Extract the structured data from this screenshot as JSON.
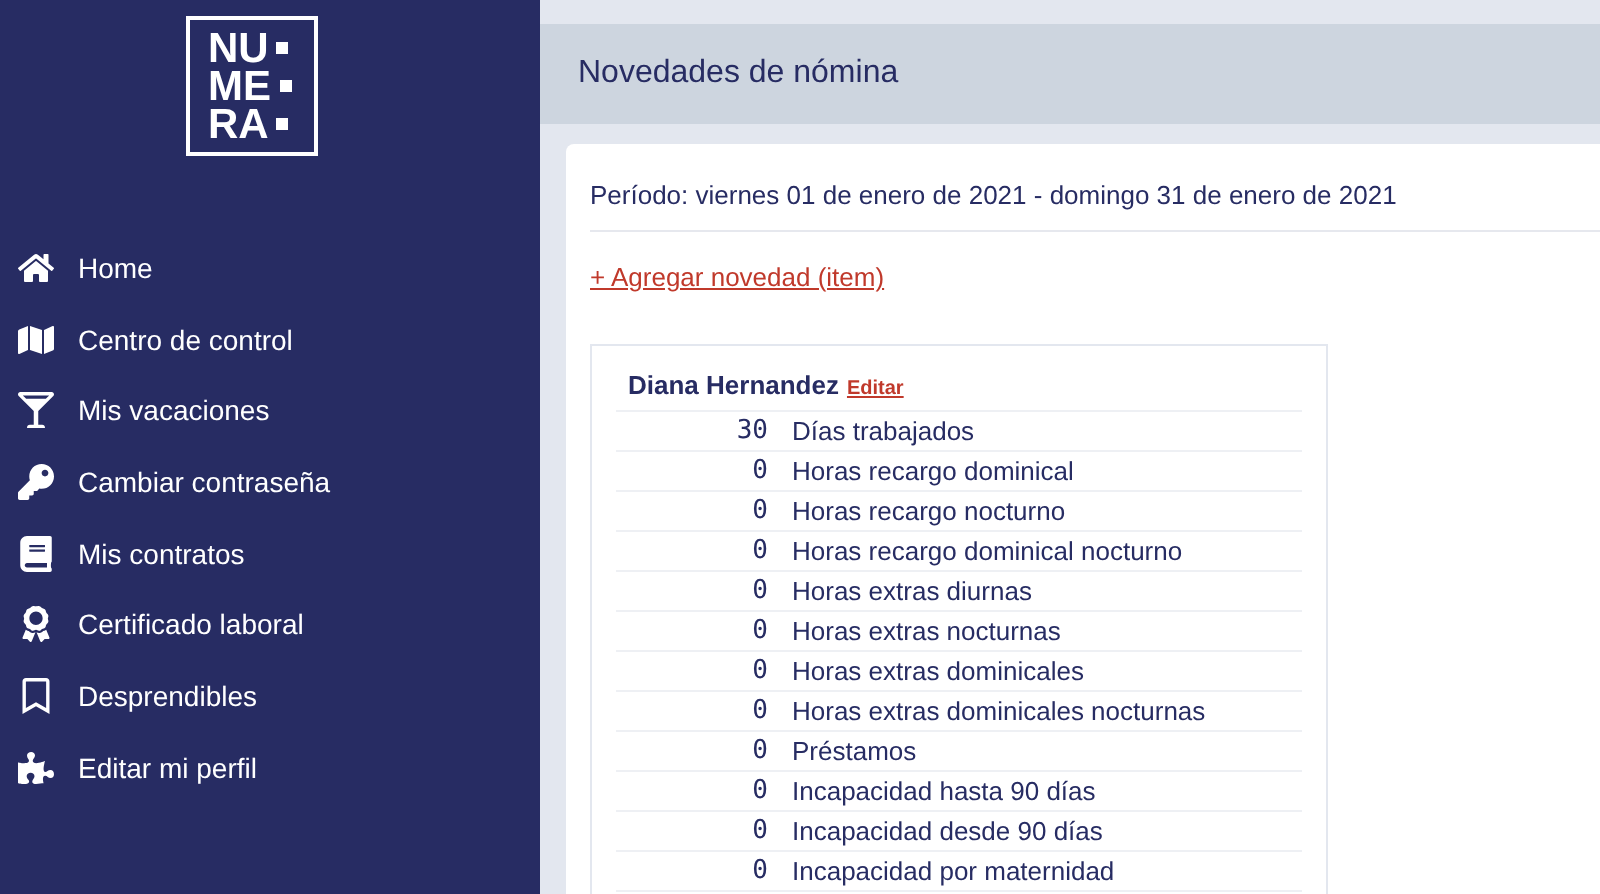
{
  "logo": {
    "lines": [
      "NU",
      "ME",
      "RA"
    ]
  },
  "sidebar": {
    "items": [
      {
        "label": "Home",
        "selected": false
      },
      {
        "label": "Centro de control",
        "selected": false
      },
      {
        "label": "Mis vacaciones",
        "selected": false
      },
      {
        "label": "Cambiar contraseña",
        "selected": false
      },
      {
        "label": "Mis contratos",
        "selected": false
      },
      {
        "label": "Certificado laboral",
        "selected": false
      },
      {
        "label": "Desprendibles",
        "selected": false
      },
      {
        "label": "Editar mi perfil",
        "selected": false
      }
    ]
  },
  "header": {
    "title": "Novedades de nómina"
  },
  "period": "Período: viernes 01 de enero de 2021 - domingo 31 de enero de 2021",
  "add_link": "+ Agregar novedad (item)",
  "employee": {
    "name": "Diana Hernandez",
    "edit_link": "Editar",
    "rows": [
      {
        "value": "30",
        "label": "Días trabajados"
      },
      {
        "value": "0",
        "label": "Horas recargo dominical"
      },
      {
        "value": "0",
        "label": "Horas recargo nocturno"
      },
      {
        "value": "0",
        "label": "Horas recargo dominical nocturno"
      },
      {
        "value": "0",
        "label": "Horas extras diurnas"
      },
      {
        "value": "0",
        "label": "Horas extras nocturnas"
      },
      {
        "value": "0",
        "label": "Horas extras dominicales"
      },
      {
        "value": "0",
        "label": "Horas extras dominicales nocturnas"
      },
      {
        "value": "0",
        "label": "Préstamos"
      },
      {
        "value": "0",
        "label": "Incapacidad hasta 90 días"
      },
      {
        "value": "0",
        "label": "Incapacidad desde 90 días"
      },
      {
        "value": "0",
        "label": "Incapacidad por maternidad"
      }
    ]
  }
}
